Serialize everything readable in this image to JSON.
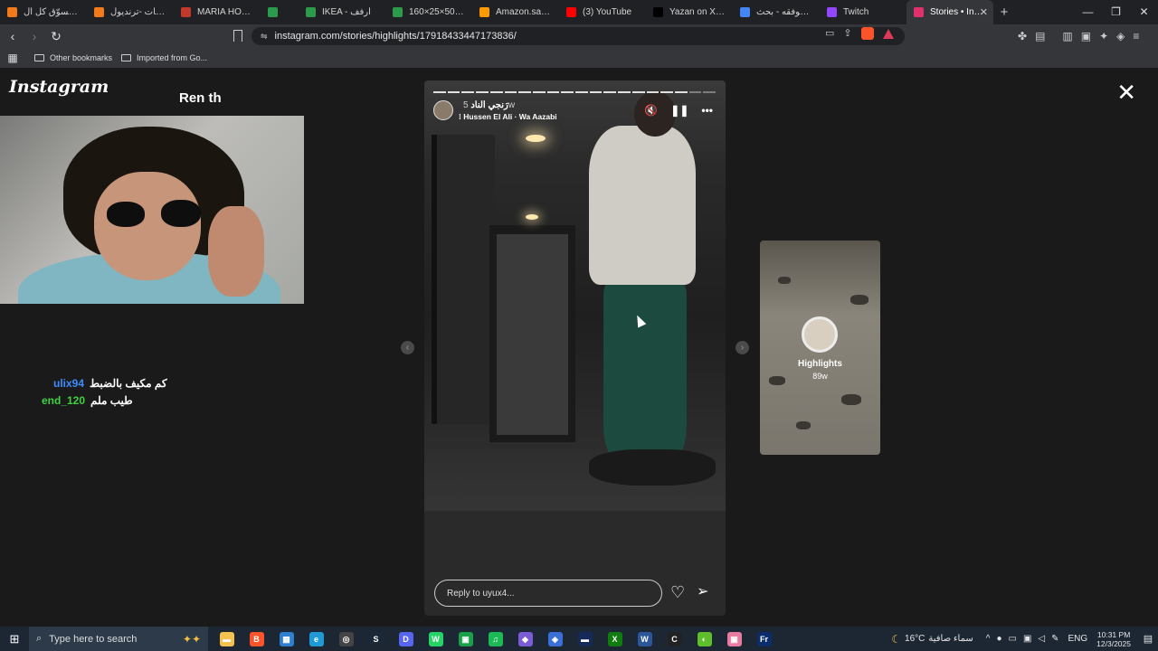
{
  "browser": {
    "tabs": [
      {
        "label": "ترنديول: تسوّق كل ال",
        "icon": "trendyol-icon",
        "color": "#f27a1a"
      },
      {
        "label": "كل منتجات -ترنديول",
        "icon": "trendyol-icon",
        "color": "#f27a1a"
      },
      {
        "label": "MARIA HOMES - ظرف",
        "icon": "maria-homes-icon",
        "color": "#c0392b"
      },
      {
        "label": "",
        "icon": "ikea-icon",
        "color": "#2b9a4a"
      },
      {
        "label": "IKEA - ارفف",
        "icon": "ikea-icon",
        "color": "#2b9a4a"
      },
      {
        "label": "مكتبة 50×25×160 ...",
        "icon": "ikea-icon",
        "color": "#2b9a4a"
      },
      {
        "label": "Amazon.sa : جدارية",
        "icon": "amazon-icon",
        "color": "#ff9900"
      },
      {
        "label": "(3) YouTube",
        "icon": "youtube-icon",
        "color": "#ff0000"
      },
      {
        "label": "Yazan on X: \"@M7m",
        "icon": "x-icon",
        "color": "#000000"
      },
      {
        "label": "كوفقه - بحث Google",
        "icon": "google-icon",
        "color": "#4285f4"
      },
      {
        "label": "Twitch",
        "icon": "twitch-icon",
        "color": "#9146ff"
      },
      {
        "label": "Stories • Instagram",
        "icon": "instagram-icon",
        "color": "#e1306c",
        "active": true
      }
    ],
    "new_tab": "+",
    "url": "instagram.com/stories/highlights/17918433447173836/",
    "bookmarks": [
      {
        "label": "Other bookmarks"
      },
      {
        "label": "Imported from Go..."
      }
    ]
  },
  "instagram": {
    "logo": "Instagram",
    "close": "✕",
    "story": {
      "username": "رَنجي الناد",
      "age": "5w",
      "music": "Hussen El Ali · Wa Aazabi",
      "reply_placeholder": "Reply to uyux4...",
      "progress_segments": 20,
      "progress_done": 18
    },
    "next_highlight": {
      "title": "Highlights",
      "age": "89w"
    }
  },
  "overlay": {
    "cam_caption": "Ren th",
    "chat": [
      {
        "user": "ulix94",
        "message": "كم مكيف بالضبط",
        "color": "#3f8cff"
      },
      {
        "user": "end_120",
        "message": "طيب ملم",
        "color": "#3fd13f"
      }
    ]
  },
  "taskbar": {
    "search_placeholder": "Type here to search",
    "weather_temp": "16°C",
    "weather_text": "سماء صافية",
    "language": "ENG",
    "time": "10:31 PM",
    "date": "12/3/2025",
    "apps": [
      {
        "icon": "file-explorer-icon",
        "color": "#f2c14e",
        "glyph": "▬"
      },
      {
        "icon": "brave-icon",
        "color": "#fb542b",
        "glyph": "B"
      },
      {
        "icon": "store-icon",
        "color": "#2f7fd0",
        "glyph": "▦"
      },
      {
        "icon": "edge-icon",
        "color": "#1f9ad6",
        "glyph": "e"
      },
      {
        "icon": "app-icon",
        "color": "#444",
        "glyph": "◎"
      },
      {
        "icon": "steam-icon",
        "color": "#1b2838",
        "glyph": "S"
      },
      {
        "icon": "discord-icon",
        "color": "#5865f2",
        "glyph": "D"
      },
      {
        "icon": "whatsapp-icon",
        "color": "#25d366",
        "glyph": "W"
      },
      {
        "icon": "app-green-icon",
        "color": "#18a04a",
        "glyph": "▣"
      },
      {
        "icon": "spotify-icon",
        "color": "#1db954",
        "glyph": "♫"
      },
      {
        "icon": "app-purple-icon",
        "color": "#7b5cd6",
        "glyph": "◆"
      },
      {
        "icon": "app-blue-icon",
        "color": "#3a6fd8",
        "glyph": "◈"
      },
      {
        "icon": "app-dark-icon",
        "color": "#162a5a",
        "glyph": "▬"
      },
      {
        "icon": "xbox-icon",
        "color": "#107c10",
        "glyph": "X"
      },
      {
        "icon": "word-icon",
        "color": "#2b579a",
        "glyph": "W"
      },
      {
        "icon": "capcut-icon",
        "color": "#222",
        "glyph": "C"
      },
      {
        "icon": "app-lime-icon",
        "color": "#5fbf2a",
        "glyph": "◐"
      },
      {
        "icon": "app-pink-icon",
        "color": "#e87ba0",
        "glyph": "▣"
      },
      {
        "icon": "fresco-icon",
        "color": "#0b2d6b",
        "glyph": "Fr"
      }
    ]
  }
}
